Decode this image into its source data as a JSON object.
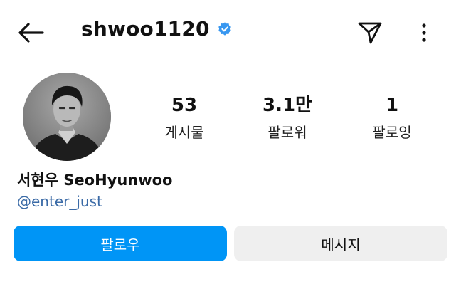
{
  "header": {
    "username": "shwoo1120",
    "verified_color": "#3897f0",
    "back_icon": "arrow-left-icon",
    "send_icon": "paper-plane-icon",
    "more_icon": "more-vertical-icon"
  },
  "profile": {
    "avatar_icon": "profile-photo",
    "display_name": "서현우 SeoHyunwoo",
    "handle_link": "@enter_just"
  },
  "stats": {
    "posts": {
      "value": "53",
      "label": "게시물"
    },
    "followers": {
      "value": "3.1만",
      "label": "팔로워"
    },
    "following": {
      "value": "1",
      "label": "팔로잉"
    }
  },
  "actions": {
    "follow_label": "팔로우",
    "message_label": "메시지",
    "accent_color": "#0095f6"
  }
}
